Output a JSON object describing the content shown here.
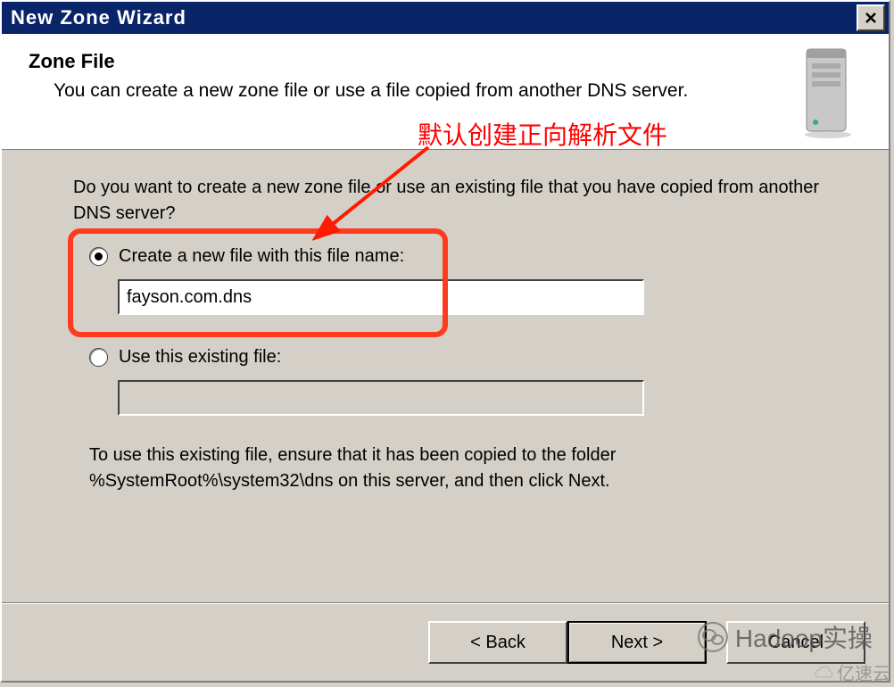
{
  "titlebar": {
    "title": "New Zone Wizard"
  },
  "header": {
    "title": "Zone File",
    "subtitle": "You can create a new zone file or use a file copied from another DNS server."
  },
  "annotation": {
    "text": "默认创建正向解析文件"
  },
  "content": {
    "prompt": "Do you want to create a new zone file or use an existing file that you have copied from another DNS server?",
    "radio1_label": "Create a new file with this file name:",
    "radio1_value": "fayson.com.dns",
    "radio2_label": "Use this existing file:",
    "radio2_value": "",
    "footnote": "To use this existing file, ensure that it has been copied to the folder %SystemRoot%\\system32\\dns on this server, and then click Next."
  },
  "buttons": {
    "back": "< Back",
    "next": "Next >",
    "cancel": "Cancel"
  },
  "watermarks": {
    "w1": "Hadoop实操",
    "w2": "亿速云"
  }
}
